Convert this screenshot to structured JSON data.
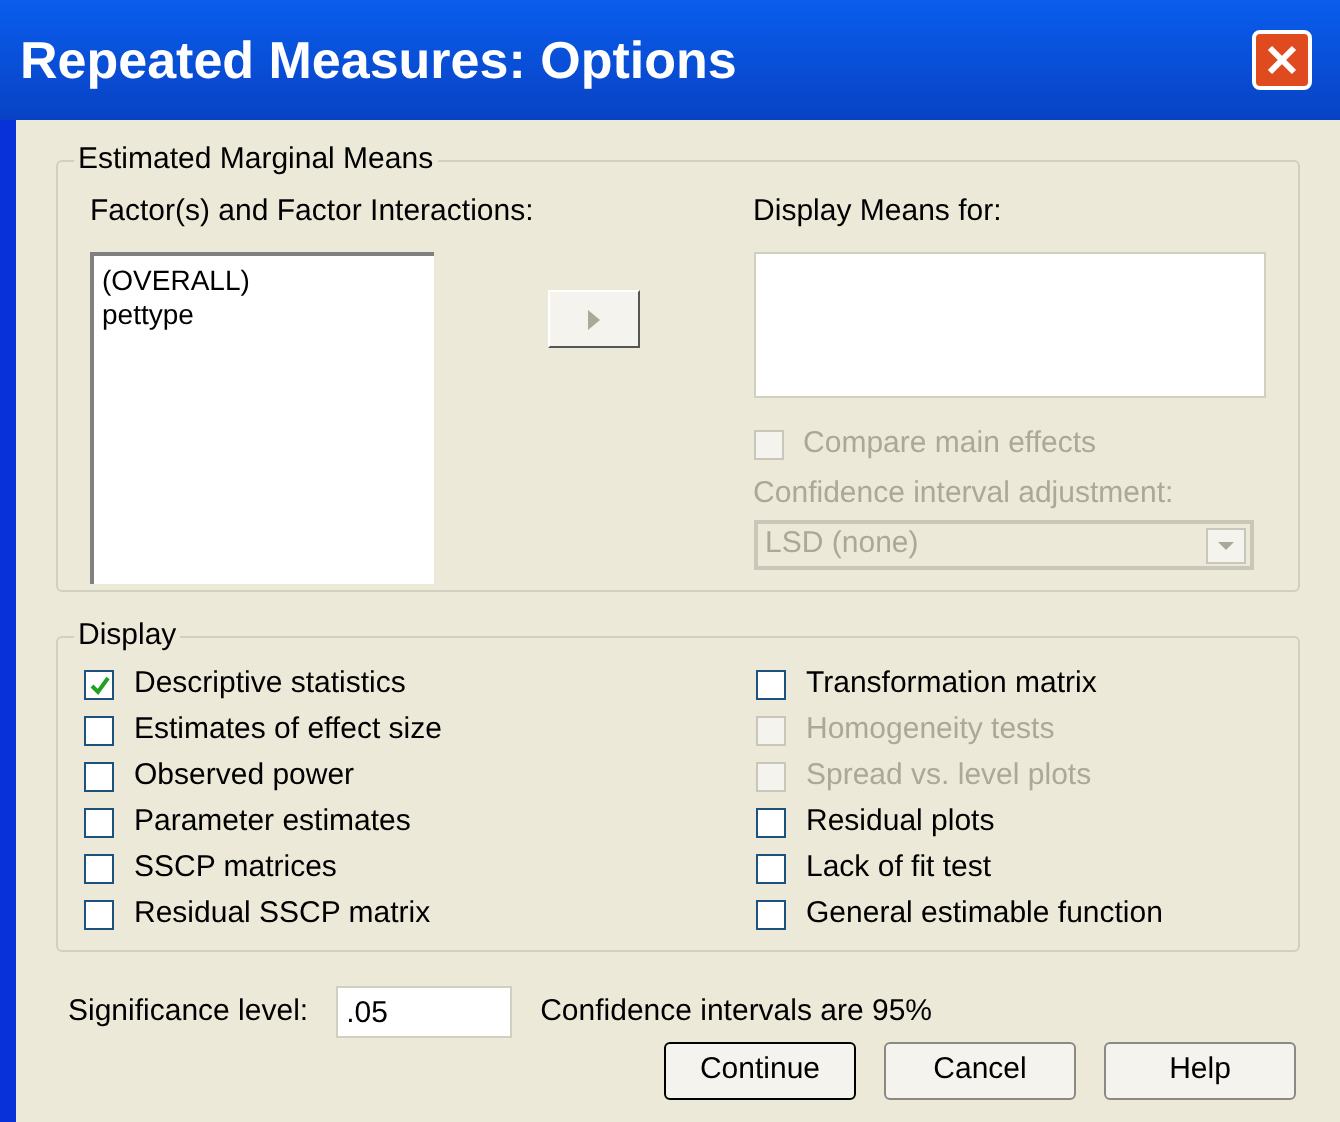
{
  "window": {
    "title": "Repeated Measures: Options"
  },
  "estimated_marginal_means": {
    "title": "Estimated Marginal Means",
    "factors_label": "Factor(s) and Factor Interactions:",
    "factors": [
      "(OVERALL)",
      "pettype"
    ],
    "display_means_label": "Display Means for:",
    "compare_main_effects": {
      "label": "Compare main effects",
      "checked": false,
      "disabled": true
    },
    "adjustment_label": "Confidence interval adjustment:",
    "adjustment": {
      "value": "LSD (none)",
      "disabled": true
    }
  },
  "display": {
    "title": "Display",
    "options": [
      {
        "label": "Descriptive statistics",
        "checked": true,
        "disabled": false
      },
      {
        "label": "Estimates of effect size",
        "checked": false,
        "disabled": false
      },
      {
        "label": "Observed power",
        "checked": false,
        "disabled": false
      },
      {
        "label": "Parameter estimates",
        "checked": false,
        "disabled": false
      },
      {
        "label": "SSCP matrices",
        "checked": false,
        "disabled": false
      },
      {
        "label": "Residual SSCP matrix",
        "checked": false,
        "disabled": false
      },
      {
        "label": "Transformation matrix",
        "checked": false,
        "disabled": false
      },
      {
        "label": "Homogeneity tests",
        "checked": false,
        "disabled": true
      },
      {
        "label": "Spread vs. level plots",
        "checked": false,
        "disabled": true
      },
      {
        "label": "Residual plots",
        "checked": false,
        "disabled": false
      },
      {
        "label": "Lack of fit test",
        "checked": false,
        "disabled": false
      },
      {
        "label": "General estimable function",
        "checked": false,
        "disabled": false
      }
    ]
  },
  "significance": {
    "label": "Significance level:",
    "value": ".05",
    "note": "Confidence intervals are 95%"
  },
  "buttons": [
    "Continue",
    "Cancel",
    "Help"
  ]
}
